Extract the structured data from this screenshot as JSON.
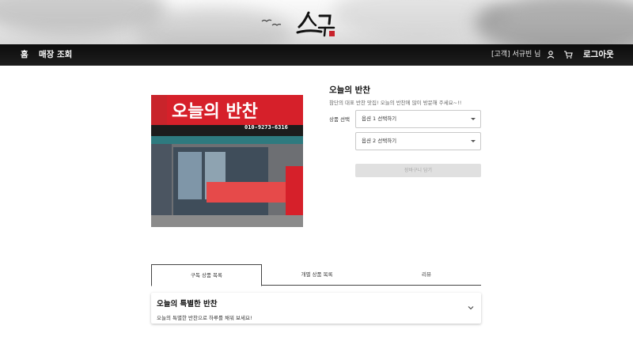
{
  "brand": {
    "logo_icon": "brush-calligraphy-logo-icon",
    "seal_color": "#c8232c"
  },
  "nav": {
    "home_label": "홈",
    "store_search_label": "매장 조회",
    "user_name": "[고객] 서규빈 님",
    "user_icon": "user-icon",
    "cart_icon": "cart-icon",
    "logout_label": "로그아웃"
  },
  "product": {
    "image_icon": "storefront-photo",
    "sign_text": "오늘의 반찬",
    "sign_phone": "010-9273-6316",
    "title": "오늘의 반찬",
    "description": "참단의 대표 반찬 맛집! 오늘의 반찬에 많이 방문해 주세요~!!",
    "option_label": "상품 선택",
    "option1_placeholder": "옵션 1 선택하기",
    "option2_placeholder": "옵션 2 선택하기",
    "cart_button_label": "장바구니 담기"
  },
  "tabs": [
    {
      "label": "구독 상품 목록",
      "active": true
    },
    {
      "label": "개별 상품 목록",
      "active": false
    },
    {
      "label": "리뷰",
      "active": false
    }
  ],
  "accordion": {
    "title": "오늘의 특별한 반찬",
    "subtitle": "오늘의 특별한 반찬으로 하루를 채워 보세요!",
    "chevron_icon": "chevron-down-icon"
  },
  "colors": {
    "nav_bg": "#111111",
    "accent_red": "#d4222b",
    "disabled_btn": "#e0e0e0"
  }
}
